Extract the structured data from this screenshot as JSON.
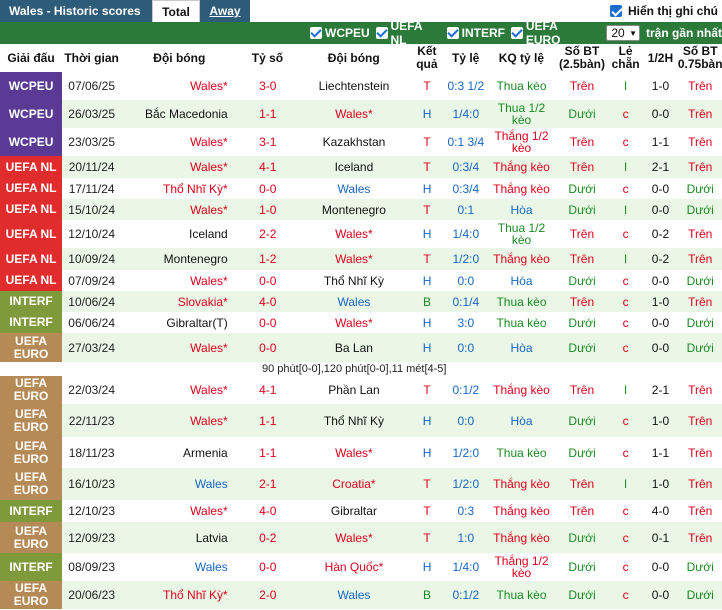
{
  "header": {
    "title": "Wales - Historic scores",
    "tab_total": "Total",
    "tab_away": "Away",
    "show_half": "Hiển thị ghi chú"
  },
  "filters": {
    "items": [
      "WCPEU",
      "UEFA NL",
      "INTERF",
      "UEFA EURO"
    ],
    "select_value": "20",
    "recent_label": "trận gần nhất"
  },
  "columns": {
    "comp": "Giải đấu",
    "date": "Thời gian",
    "home": "Đội bóng",
    "score": "Tỷ số",
    "away": "Đội bóng",
    "result": "Kết quả",
    "handicap": "Tỷ lệ",
    "handicap_result": "KQ tỷ lệ",
    "goals": "Số BT (2.5bàn)",
    "odd_even": "Lẻ chẵn",
    "half": "1/2H",
    "goals_ht": "Số BT (0.75bàn)"
  },
  "colors": {
    "WCPEU": "#5a3a94",
    "UEFA NL": "#e02c2c",
    "INTERF": "#7f9a3a",
    "UEFA EURO": "#b58a57",
    "filterbar": "#2c7a3a",
    "titlebar": "#2d5b7a"
  },
  "matches": [
    {
      "comp": "WCPEU",
      "date": "07/06/25",
      "home": "Wales*",
      "score": "3-0",
      "away": "Liechtenstein",
      "result": "T",
      "handicap": "0:3 1/2",
      "hres": "Thua kèo",
      "goals": "Trên",
      "oe": "l",
      "half": "1-0",
      "ght": "Trên"
    },
    {
      "comp": "WCPEU",
      "date": "26/03/25",
      "home": "Bắc Macedonia",
      "score": "1-1",
      "away": "Wales*",
      "result": "H",
      "handicap": "1/4:0",
      "hres": "Thua 1/2 kèo",
      "goals": "Dưới",
      "oe": "c",
      "half": "0-0",
      "ght": "Trên"
    },
    {
      "comp": "WCPEU",
      "date": "23/03/25",
      "home": "Wales*",
      "score": "3-1",
      "away": "Kazakhstan",
      "result": "T",
      "handicap": "0:1 3/4",
      "hres": "Thắng 1/2 kèo",
      "goals": "Trên",
      "oe": "c",
      "half": "1-1",
      "ght": "Trên"
    },
    {
      "comp": "UEFA NL",
      "date": "20/11/24",
      "home": "Wales*",
      "score": "4-1",
      "away": "Iceland",
      "result": "T",
      "handicap": "0:3/4",
      "hres": "Thắng kèo",
      "goals": "Trên",
      "oe": "l",
      "half": "2-1",
      "ght": "Trên"
    },
    {
      "comp": "UEFA NL",
      "date": "17/11/24",
      "home": "Thổ Nhĩ Kỳ*",
      "score": "0-0",
      "away": "Wales",
      "result": "H",
      "handicap": "0:3/4",
      "hres": "Thắng kèo",
      "goals": "Dưới",
      "oe": "c",
      "half": "0-0",
      "ght": "Dưới"
    },
    {
      "comp": "UEFA NL",
      "date": "15/10/24",
      "home": "Wales*",
      "score": "1-0",
      "away": "Montenegro",
      "result": "T",
      "handicap": "0:1",
      "hres": "Hòa",
      "goals": "Dưới",
      "oe": "l",
      "half": "0-0",
      "ght": "Dưới"
    },
    {
      "comp": "UEFA NL",
      "date": "12/10/24",
      "home": "Iceland",
      "score": "2-2",
      "away": "Wales*",
      "result": "H",
      "handicap": "1/4:0",
      "hres": "Thua 1/2 kèo",
      "goals": "Trên",
      "oe": "c",
      "half": "0-2",
      "ght": "Trên"
    },
    {
      "comp": "UEFA NL",
      "date": "10/09/24",
      "home": "Montenegro",
      "score": "1-2",
      "away": "Wales*",
      "result": "T",
      "handicap": "1/2:0",
      "hres": "Thắng kèo",
      "goals": "Trên",
      "oe": "l",
      "half": "0-2",
      "ght": "Trên"
    },
    {
      "comp": "UEFA NL",
      "date": "07/09/24",
      "home": "Wales*",
      "score": "0-0",
      "away": "Thổ Nhĩ Kỳ",
      "result": "H",
      "handicap": "0:0",
      "hres": "Hòa",
      "goals": "Dưới",
      "oe": "c",
      "half": "0-0",
      "ght": "Dưới"
    },
    {
      "comp": "INTERF",
      "date": "10/06/24",
      "home": "Slovakia*",
      "score": "4-0",
      "away": "Wales",
      "result": "B",
      "handicap": "0:1/4",
      "hres": "Thua kèo",
      "goals": "Trên",
      "oe": "c",
      "half": "1-0",
      "ght": "Trên"
    },
    {
      "comp": "INTERF",
      "date": "06/06/24",
      "home": "Gibraltar(T)",
      "score": "0-0",
      "away": "Wales*",
      "result": "H",
      "handicap": "3:0",
      "hres": "Thua kèo",
      "goals": "Dưới",
      "oe": "c",
      "half": "0-0",
      "ght": "Dưới"
    },
    {
      "comp": "UEFA EURO",
      "date": "27/03/24",
      "home": "Wales*",
      "score": "0-0",
      "away": "Ba Lan",
      "result": "H",
      "handicap": "0:0",
      "hres": "Hòa",
      "goals": "Dưới",
      "oe": "c",
      "half": "0-0",
      "ght": "Dưới"
    },
    {
      "comp": "UEFA EURO",
      "date": "22/03/24",
      "home": "Wales*",
      "score": "4-1",
      "away": "Phần Lan",
      "result": "T",
      "handicap": "0:1/2",
      "hres": "Thắng kèo",
      "goals": "Trên",
      "oe": "l",
      "half": "2-1",
      "ght": "Trên"
    },
    {
      "comp": "UEFA EURO",
      "date": "22/11/23",
      "home": "Wales*",
      "score": "1-1",
      "away": "Thổ Nhĩ Kỳ",
      "result": "H",
      "handicap": "0:0",
      "hres": "Hòa",
      "goals": "Dưới",
      "oe": "c",
      "half": "1-0",
      "ght": "Trên"
    },
    {
      "comp": "UEFA EURO",
      "date": "18/11/23",
      "home": "Armenia",
      "score": "1-1",
      "away": "Wales*",
      "result": "H",
      "handicap": "1/2:0",
      "hres": "Thua kèo",
      "goals": "Dưới",
      "oe": "c",
      "half": "1-1",
      "ght": "Trên"
    },
    {
      "comp": "UEFA EURO",
      "date": "16/10/23",
      "home": "Wales",
      "score": "2-1",
      "away": "Croatia*",
      "result": "T",
      "handicap": "1/2:0",
      "hres": "Thắng kèo",
      "goals": "Trên",
      "oe": "l",
      "half": "1-0",
      "ght": "Trên"
    },
    {
      "comp": "INTERF",
      "date": "12/10/23",
      "home": "Wales*",
      "score": "4-0",
      "away": "Gibraltar",
      "result": "T",
      "handicap": "0:3",
      "hres": "Thắng kèo",
      "goals": "Trên",
      "oe": "c",
      "half": "4-0",
      "ght": "Trên"
    },
    {
      "comp": "UEFA EURO",
      "date": "12/09/23",
      "home": "Latvia",
      "score": "0-2",
      "away": "Wales*",
      "result": "T",
      "handicap": "1:0",
      "hres": "Thắng kèo",
      "goals": "Dưới",
      "oe": "c",
      "half": "0-1",
      "ght": "Trên"
    },
    {
      "comp": "INTERF",
      "date": "08/09/23",
      "home": "Wales",
      "score": "0-0",
      "away": "Hàn Quốc*",
      "result": "H",
      "handicap": "1/4:0",
      "hres": "Thắng 1/2 kèo",
      "goals": "Dưới",
      "oe": "c",
      "half": "0-0",
      "ght": "Dưới"
    },
    {
      "comp": "UEFA EURO",
      "date": "20/06/23",
      "home": "Thổ Nhĩ Kỳ*",
      "score": "2-0",
      "away": "Wales",
      "result": "B",
      "handicap": "0:1/2",
      "hres": "Thua kèo",
      "goals": "Dưới",
      "oe": "c",
      "half": "0-0",
      "ght": "Dưới"
    }
  ],
  "penalty_note": "90 phút[0-0],120 phút[0-0],11 mét[4-5]"
}
